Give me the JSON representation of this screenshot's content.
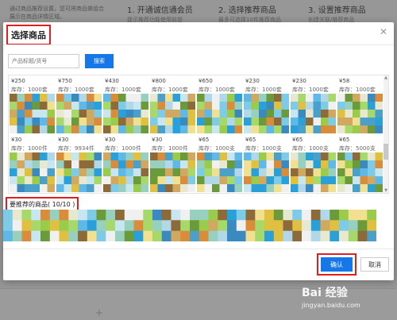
{
  "background": {
    "intro": "通过商品推荐设置，您可将商品做组合展示在商品详情区域。",
    "steps": [
      {
        "title": "1. 开通诚信通会员",
        "sub": "提示推荐功能使用前提"
      },
      {
        "title": "2. 选择推荐商品",
        "sub": "最多可选择10件推荐商品"
      },
      {
        "title": "3. 设置推荐商品",
        "sub": "创建关联/推荐商品"
      }
    ]
  },
  "dialog": {
    "title": "选择商品",
    "close_icon": "close-icon",
    "search": {
      "placeholder": "产品标题/货号",
      "button": "搜索"
    },
    "products_row1": [
      {
        "price": "¥250",
        "stock": "库存：1000套"
      },
      {
        "price": "¥750",
        "stock": "库存：1000套"
      },
      {
        "price": "¥430",
        "stock": "库存：1000套"
      },
      {
        "price": "¥800",
        "stock": "库存：1000套"
      },
      {
        "price": "¥650",
        "stock": "库存：1000套"
      },
      {
        "price": "¥230",
        "stock": "库存：1000套"
      },
      {
        "price": "¥230",
        "stock": "库存：1000套"
      },
      {
        "price": "¥58",
        "stock": "库存：1000套"
      }
    ],
    "products_row2": [
      {
        "price": "¥30",
        "stock": "库存：1000件"
      },
      {
        "price": "¥30",
        "stock": "库存：9934件"
      },
      {
        "price": "¥30",
        "stock": "库存：1000件"
      },
      {
        "price": "¥30",
        "stock": "库存：1000件"
      },
      {
        "price": "¥65",
        "stock": "库存：1000支"
      },
      {
        "price": "¥65",
        "stock": "库存：1000支"
      },
      {
        "price": "¥65",
        "stock": "库存：1000支"
      },
      {
        "price": "¥65",
        "stock": "库存：5000支"
      }
    ],
    "selected_label": "要推荐的商品( 10/10 )",
    "confirm": "确认",
    "cancel": "取消"
  },
  "watermark": {
    "logo": "Bai 经验",
    "url": "jingyan.baidu.com"
  },
  "colors": {
    "accent": "#1677e8",
    "highlight": "#e02020"
  }
}
